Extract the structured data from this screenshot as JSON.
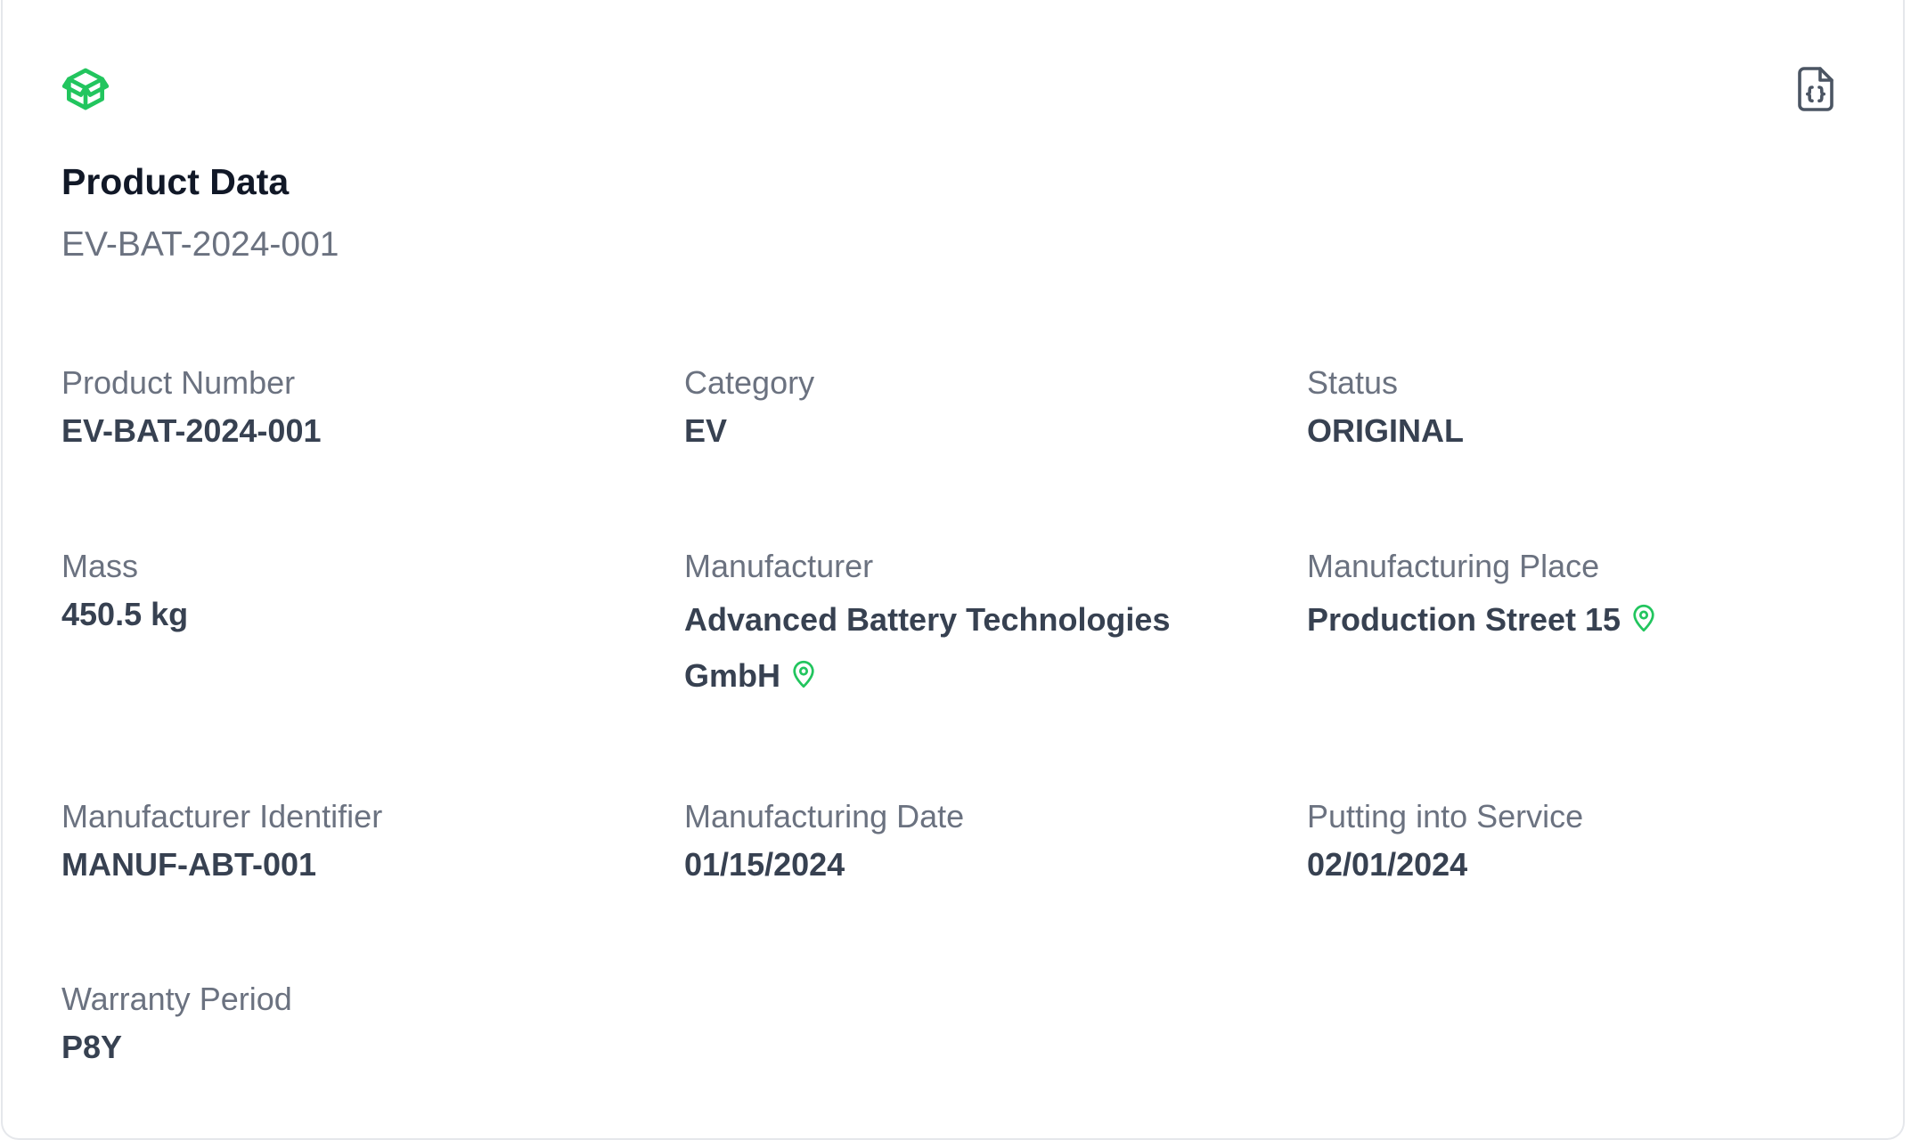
{
  "card": {
    "title": "Product Data",
    "subtitle": "EV-BAT-2024-001",
    "icons": {
      "header": "box-icon",
      "export": "file-json-icon",
      "location": "map-pin-icon"
    },
    "colors": {
      "accent": "#22c55e",
      "title": "#111827",
      "label": "#6b7280",
      "value": "#374151",
      "border": "#e5e7eb"
    }
  },
  "fields": {
    "product_number": {
      "label": "Product Number",
      "value": "EV-BAT-2024-001"
    },
    "category": {
      "label": "Category",
      "value": "EV"
    },
    "status": {
      "label": "Status",
      "value": "ORIGINAL"
    },
    "mass": {
      "label": "Mass",
      "value": "450.5 kg"
    },
    "manufacturer": {
      "label": "Manufacturer",
      "value": "Advanced Battery Technologies GmbH"
    },
    "manufacturing_place": {
      "label": "Manufacturing Place",
      "value": "Production Street 15"
    },
    "manufacturer_identifier": {
      "label": "Manufacturer Identifier",
      "value": "MANUF-ABT-001"
    },
    "manufacturing_date": {
      "label": "Manufacturing Date",
      "value": "01/15/2024"
    },
    "putting_into_service": {
      "label": "Putting into Service",
      "value": "02/01/2024"
    },
    "warranty_period": {
      "label": "Warranty Period",
      "value": "P8Y"
    }
  }
}
